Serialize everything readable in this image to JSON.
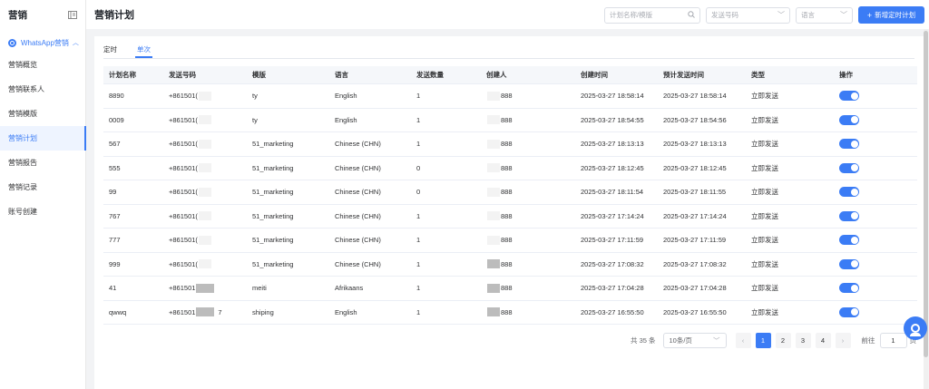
{
  "sidebar": {
    "title": "营销",
    "group": {
      "label": "WhatsApp营销"
    },
    "items": [
      {
        "label": "营销概览"
      },
      {
        "label": "营销联系人"
      },
      {
        "label": "营销模版"
      },
      {
        "label": "营销计划",
        "active": true
      },
      {
        "label": "营销报告"
      },
      {
        "label": "营销记录"
      },
      {
        "label": "账号创建"
      }
    ]
  },
  "header": {
    "title": "营销计划",
    "search_placeholder": "计划名称/模版",
    "number_placeholder": "发送号码",
    "language_placeholder": "语言",
    "new_button": "新增定时计划"
  },
  "tabs": [
    {
      "label": "定时"
    },
    {
      "label": "单次",
      "active": true
    }
  ],
  "table": {
    "columns": [
      "计划名称",
      "发送号码",
      "模版",
      "语言",
      "发送数量",
      "创建人",
      "创建时间",
      "预计发送时间",
      "类型",
      "操作"
    ],
    "rows": [
      {
        "name": "8890",
        "phone": "+861501(",
        "template": "ty",
        "language": "English",
        "count": "1",
        "creator": "888",
        "created": "2025-03-27 18:58:14",
        "scheduled": "2025-03-27 18:58:14",
        "type": "立即发送"
      },
      {
        "name": "0009",
        "phone": "+861501(",
        "template": "ty",
        "language": "English",
        "count": "1",
        "creator": "888",
        "created": "2025-03-27 18:54:55",
        "scheduled": "2025-03-27 18:54:56",
        "type": "立即发送"
      },
      {
        "name": "567",
        "phone": "+861501(",
        "template": "51_marketing",
        "language": "Chinese (CHN)",
        "count": "1",
        "creator": "888",
        "created": "2025-03-27 18:13:13",
        "scheduled": "2025-03-27 18:13:13",
        "type": "立即发送"
      },
      {
        "name": "555",
        "phone": "+861501(",
        "template": "51_marketing",
        "language": "Chinese (CHN)",
        "count": "0",
        "creator": "888",
        "created": "2025-03-27 18:12:45",
        "scheduled": "2025-03-27 18:12:45",
        "type": "立即发送"
      },
      {
        "name": "99",
        "phone": "+861501(",
        "template": "51_marketing",
        "language": "Chinese (CHN)",
        "count": "0",
        "creator": "888",
        "created": "2025-03-27 18:11:54",
        "scheduled": "2025-03-27 18:11:55",
        "type": "立即发送"
      },
      {
        "name": "767",
        "phone": "+861501(",
        "template": "51_marketing",
        "language": "Chinese (CHN)",
        "count": "1",
        "creator": "888",
        "created": "2025-03-27 17:14:24",
        "scheduled": "2025-03-27 17:14:24",
        "type": "立即发送"
      },
      {
        "name": "777",
        "phone": "+861501(",
        "template": "51_marketing",
        "language": "Chinese (CHN)",
        "count": "1",
        "creator": "888",
        "created": "2025-03-27 17:11:59",
        "scheduled": "2025-03-27 17:11:59",
        "type": "立即发送"
      },
      {
        "name": "999",
        "phone": "+861501(",
        "template": "51_marketing",
        "language": "Chinese (CHN)",
        "count": "1",
        "creator": "888",
        "created": "2025-03-27 17:08:32",
        "scheduled": "2025-03-27 17:08:32",
        "type": "立即发送"
      },
      {
        "name": "41",
        "phone": "+861501",
        "template": "meiti",
        "language": "Afrikaans",
        "count": "1",
        "creator": "888",
        "created": "2025-03-27 17:04:28",
        "scheduled": "2025-03-27 17:04:28",
        "type": "立即发送"
      },
      {
        "name": "qwwq",
        "phone": "+861501",
        "phone_suffix": "7",
        "template": "shiping",
        "language": "English",
        "count": "1",
        "creator": "888",
        "created": "2025-03-27 16:55:50",
        "scheduled": "2025-03-27 16:55:50",
        "type": "立即发送"
      }
    ]
  },
  "pagination": {
    "total": "共 35 条",
    "page_size": "10条/页",
    "pages": [
      "1",
      "2",
      "3",
      "4"
    ],
    "current": "1",
    "goto_label": "前往",
    "goto_value": "1",
    "goto_suffix": "页"
  },
  "colors": {
    "accent": "#3b7cf5"
  }
}
